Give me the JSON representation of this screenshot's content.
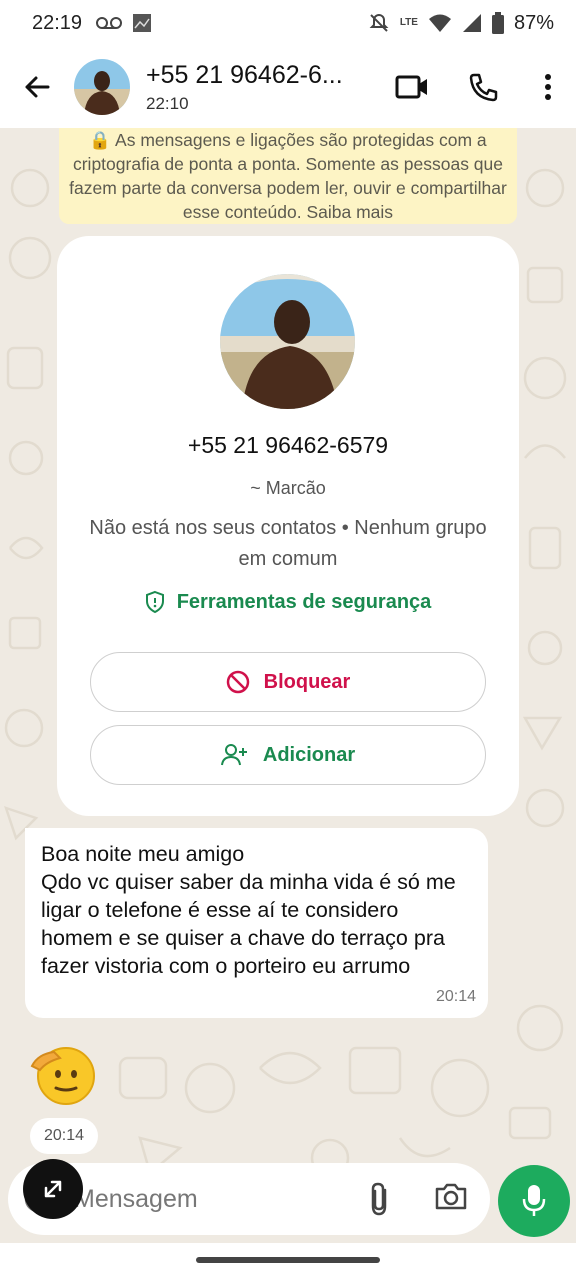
{
  "status_bar": {
    "time": "22:19",
    "network": "LTE",
    "battery": "87%"
  },
  "app_bar": {
    "contact_name": "+55 21 96462-6...",
    "subtitle": "22:10"
  },
  "chat": {
    "encryption_notice": "🔒 As mensagens e ligações são protegidas com a criptografia de ponta a ponta. Somente as pessoas que fazem parte da conversa podem ler, ouvir e compartilhar esse conteúdo. Saiba mais",
    "profile_card": {
      "phone": "+55 21 96462-6579",
      "nickname": "~ Marcão",
      "info": "Não está nos seus contatos • Nenhum grupo em comum",
      "safety_tools": "Ferramentas de segurança",
      "block_label": "Bloquear",
      "add_label": "Adicionar"
    },
    "message": {
      "text": "Boa noite meu amigo\nQdo vc quiser saber da minha vida é só me ligar o telefone é esse aí te considero homem e se quiser a chave do terraço pra fazer vistoria com o porteiro eu arrumo",
      "time": "20:14"
    },
    "sticker": {
      "icon": "saluting-face-emoji",
      "time": "20:14"
    }
  },
  "composer": {
    "placeholder": "Mensagem"
  },
  "colors": {
    "accent_green": "#1dab5e",
    "block_red": "#d0114b",
    "notice_yellow": "#fdf4c5",
    "chat_bg": "#efeae2"
  }
}
